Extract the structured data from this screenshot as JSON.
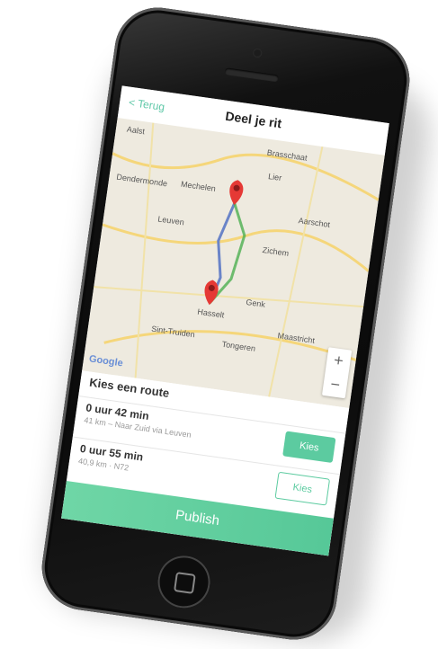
{
  "nav": {
    "back_label": "< Terug",
    "title": "Deel je rit"
  },
  "map": {
    "labels": [
      {
        "text": "Aalst"
      },
      {
        "text": "Brasschaat"
      },
      {
        "text": "Lier"
      },
      {
        "text": "Dendermonde"
      },
      {
        "text": "Mechelen"
      },
      {
        "text": "Aarschot"
      },
      {
        "text": "Leuven"
      },
      {
        "text": "Zichem"
      },
      {
        "text": "Hasselt"
      },
      {
        "text": "Genk"
      },
      {
        "text": "Sint-Truiden"
      },
      {
        "text": "Tongeren"
      },
      {
        "text": "Maastricht"
      }
    ],
    "attribution": "Google",
    "zoom_in": "+",
    "zoom_out": "−"
  },
  "routes_section": {
    "title": "Kies een route",
    "routes": [
      {
        "duration": "0 uur 42 min",
        "description": "41 km – Naar Zuid via Leuven",
        "button": "Kies"
      },
      {
        "duration": "0 uur 55 min",
        "description": "40,9 km · N72",
        "button": "Kies"
      }
    ]
  },
  "publish_label": "Publish",
  "colors": {
    "accent": "#5ccba0",
    "route": "#4caf50",
    "pin": "#e53935"
  }
}
